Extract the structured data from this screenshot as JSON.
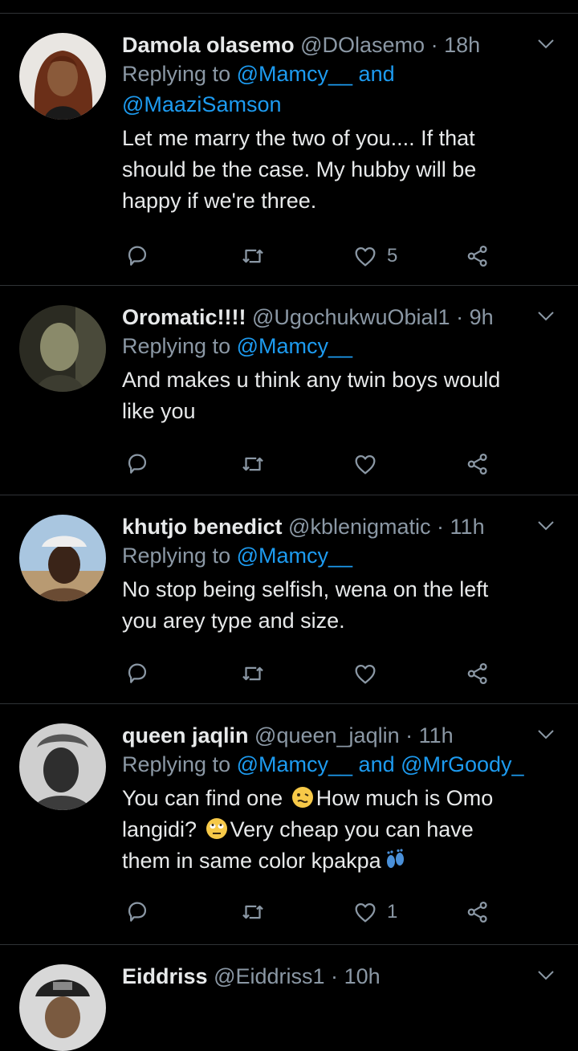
{
  "tweets": [
    {
      "name": "Damola olasemo",
      "handle": "@DOlasemo",
      "time": "18h",
      "replying_prefix": "Replying to",
      "reply_line1": "@Mamcy__ and",
      "reply_line2": "@MaaziSamson",
      "lines": [
        "Let me marry the two of you.... If that",
        "should be the case. My hubby will be",
        "happy if we're three."
      ],
      "likes": "5"
    },
    {
      "name": "Oromatic!!!!",
      "handle": "@UgochukwuObial1",
      "time": "9h",
      "replying_prefix": "Replying to",
      "reply_mentions": "@Mamcy__",
      "lines": [
        "And makes u think any twin boys would",
        "like you"
      ],
      "likes": ""
    },
    {
      "name": "khutjo benedict",
      "handle": "@kblenigmatic",
      "time": "11h",
      "replying_prefix": "Replying to",
      "reply_mentions": "@Mamcy__",
      "lines": [
        "No stop being selfish, wena on the left",
        "you arey type and size."
      ],
      "likes": ""
    },
    {
      "name": "queen jaqlin",
      "handle": "@queen_jaqlin",
      "time": "11h",
      "replying_prefix": "Replying to",
      "reply_mentions": "@Mamcy__ and @MrGoody_",
      "line1a": "You can find one",
      "line1b": "How much is Omo",
      "line2a": "langidi?",
      "line2b": "Very cheap you can have",
      "line3": "them in same color kpakpa",
      "likes": "1"
    },
    {
      "name": "Eiddriss",
      "handle": "@Eiddriss1",
      "time": "10h"
    }
  ],
  "separator": "·",
  "icons": [
    "reply-icon",
    "retweet-icon",
    "like-icon",
    "share-icon",
    "chevron-down-icon"
  ],
  "colors": {
    "background": "#000000",
    "mention": "#1d9bf0",
    "secondary": "#8b98a5"
  }
}
